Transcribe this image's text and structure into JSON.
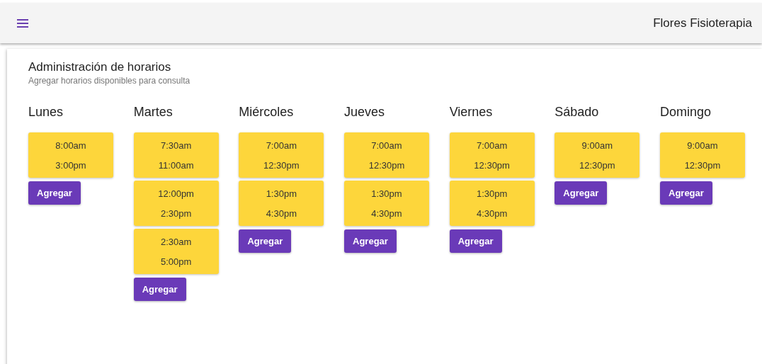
{
  "app_bar": {
    "title": "Flores Fisioterapia"
  },
  "page": {
    "title": "Administración de horarios",
    "subtitle": "Agregar horarios disponibles para consulta"
  },
  "days": [
    {
      "name": "Lunes",
      "slots": [
        {
          "start": "8:00am",
          "end": "3:00pm"
        }
      ],
      "button": "Agregar"
    },
    {
      "name": "Martes",
      "slots": [
        {
          "start": "7:30am",
          "end": "11:00am"
        },
        {
          "start": "12:00pm",
          "end": "2:30pm"
        },
        {
          "start": "2:30am",
          "end": "5:00pm"
        }
      ],
      "button": "Agregar"
    },
    {
      "name": "Miércoles",
      "slots": [
        {
          "start": "7:00am",
          "end": "12:30pm"
        },
        {
          "start": "1:30pm",
          "end": "4:30pm"
        }
      ],
      "button": "Agregar"
    },
    {
      "name": "Jueves",
      "slots": [
        {
          "start": "7:00am",
          "end": "12:30pm"
        },
        {
          "start": "1:30pm",
          "end": "4:30pm"
        }
      ],
      "button": "Agregar"
    },
    {
      "name": "Viernes",
      "slots": [
        {
          "start": "7:00am",
          "end": "12:30pm"
        },
        {
          "start": "1:30pm",
          "end": "4:30pm"
        }
      ],
      "button": "Agregar"
    },
    {
      "name": "Sábado",
      "slots": [
        {
          "start": "9:00am",
          "end": "12:30pm"
        }
      ],
      "button": "Agregar"
    },
    {
      "name": "Domingo",
      "slots": [
        {
          "start": "9:00am",
          "end": "12:30pm"
        }
      ],
      "button": "Agregar"
    }
  ]
}
